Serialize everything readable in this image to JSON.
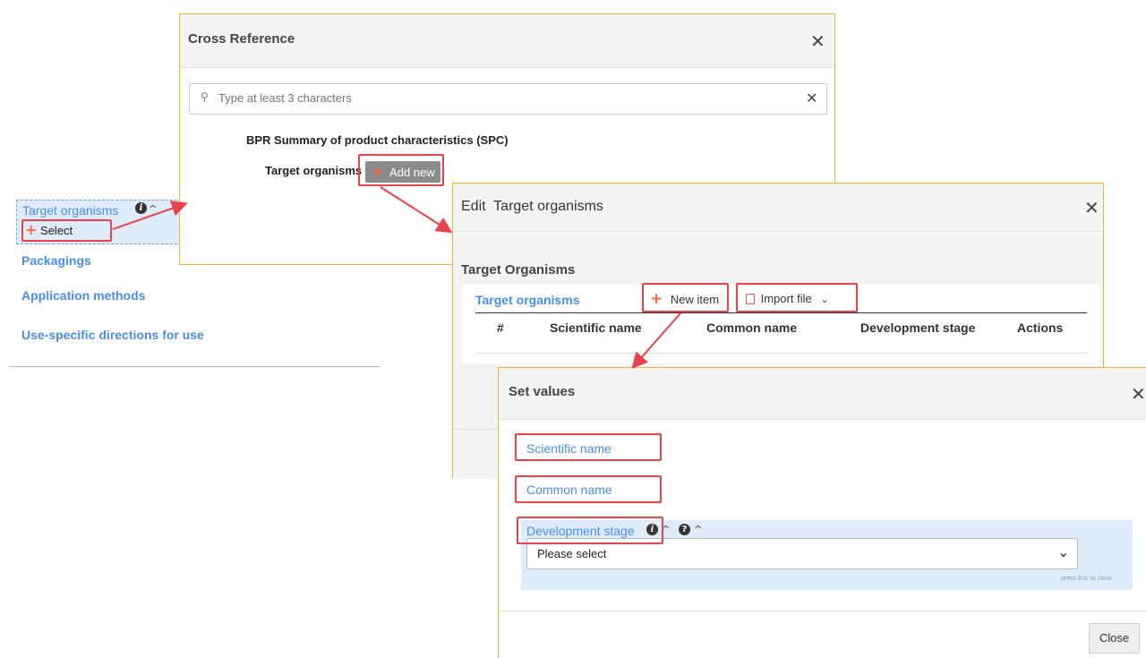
{
  "background_sidebar": {
    "target_organisms": "Target organisms",
    "select_label": "Select",
    "packagings": "Packagings",
    "application_methods": "Application methods",
    "use_specific": "Use-specific directions for use"
  },
  "cross_reference": {
    "title": "Cross Reference",
    "search_placeholder": "Type at least 3 characters",
    "section_title": "BPR Summary of product characteristics (SPC)",
    "field_label": "Target organisms",
    "add_new_label": "Add new"
  },
  "edit_modal": {
    "title": "Edit  Target organisms",
    "section_title": "Target Organisms",
    "tab_label": "Target organisms",
    "new_item_label": "New item",
    "import_file_label": "Import file",
    "columns": [
      "#",
      "Scientific name",
      "Common name",
      "Development stage",
      "Actions"
    ]
  },
  "set_values": {
    "title": "Set values",
    "scientific_name": "Scientific name",
    "common_name": "Common name",
    "development_stage": "Development stage",
    "select_value": "Please select",
    "hint": "press Esc to close",
    "close_label": "Close"
  },
  "colors": {
    "accent_link": "#4a8ee8",
    "highlight_box": "#e8434d",
    "modal_border": "#f0b52e",
    "plus_orange": "#f26a3a"
  }
}
